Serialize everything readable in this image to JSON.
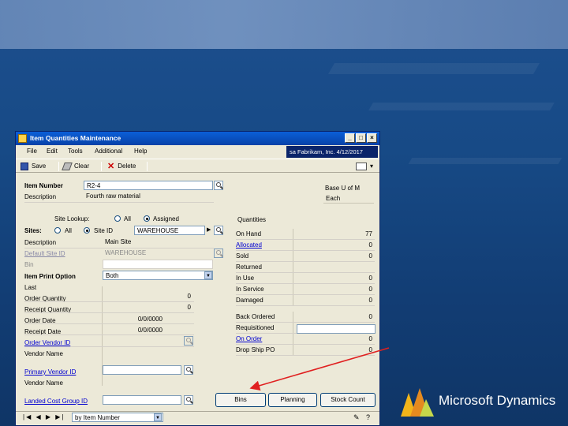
{
  "window": {
    "title": "Item Quantities Maintenance",
    "user_info": "sa  Fabrikam, Inc.  4/12/2017",
    "menu": [
      "File",
      "Edit",
      "Tools",
      "Additional",
      "Help"
    ],
    "toolbar": {
      "save": "Save",
      "clear": "Clear",
      "delete": "Delete"
    }
  },
  "header": {
    "item_number_label": "Item Number",
    "item_number": "R2-4",
    "description_label": "Description",
    "description": "Fourth raw material",
    "base_uofm_label": "Base U of M",
    "base_uofm": "Each"
  },
  "sites": {
    "lookup_label": "Site Lookup:",
    "lookup_all": "All",
    "lookup_assigned": "Assigned",
    "sites_label": "Sites:",
    "all": "All",
    "site_id": "Site ID",
    "site_value": "WAREHOUSE"
  },
  "left_fields": [
    {
      "label": "Description",
      "value": "Main Site"
    },
    {
      "label": "Default Site ID",
      "value": "WAREHOUSE"
    },
    {
      "label": "Bin",
      "value": ""
    },
    {
      "label": "Item Print Option",
      "value": "Both"
    },
    {
      "label": "Last",
      "value": ""
    },
    {
      "label": "Order Quantity",
      "value": "0"
    },
    {
      "label": "Receipt Quantity",
      "value": "0"
    },
    {
      "label": "Order Date",
      "value": "0/0/0000"
    },
    {
      "label": "Receipt Date",
      "value": "0/0/0000"
    },
    {
      "label": "Order Vendor ID",
      "value": ""
    },
    {
      "label": "Vendor Name",
      "value": ""
    },
    {
      "label": "Primary Vendor ID",
      "value": ""
    },
    {
      "label": "Vendor Name",
      "value": ""
    },
    {
      "label": "Landed Cost Group ID",
      "value": ""
    }
  ],
  "quantities": {
    "title": "Quantities",
    "rows": [
      {
        "label": "On Hand",
        "value": "77"
      },
      {
        "label": "Allocated",
        "value": "0"
      },
      {
        "label": "Sold",
        "value": "0"
      },
      {
        "label": "Returned",
        "value": ""
      },
      {
        "label": "In Use",
        "value": "0"
      },
      {
        "label": "In Service",
        "value": "0"
      },
      {
        "label": "Damaged",
        "value": "0"
      },
      {
        "label": "Back Ordered",
        "value": "0"
      },
      {
        "label": "Requisitioned",
        "value": ""
      },
      {
        "label": "On Order",
        "value": "0"
      },
      {
        "label": "Drop Ship PO",
        "value": "0"
      }
    ]
  },
  "buttons": {
    "bins": "Bins",
    "planning": "Planning",
    "stock_count": "Stock Count"
  },
  "footer": {
    "sort_by": "by Item Number"
  },
  "brand": {
    "text": "Microsoft Dynamics"
  },
  "colors": {
    "link": "#0000d0",
    "title_bar": "#0a5fd8",
    "arrow": "#e02020"
  }
}
